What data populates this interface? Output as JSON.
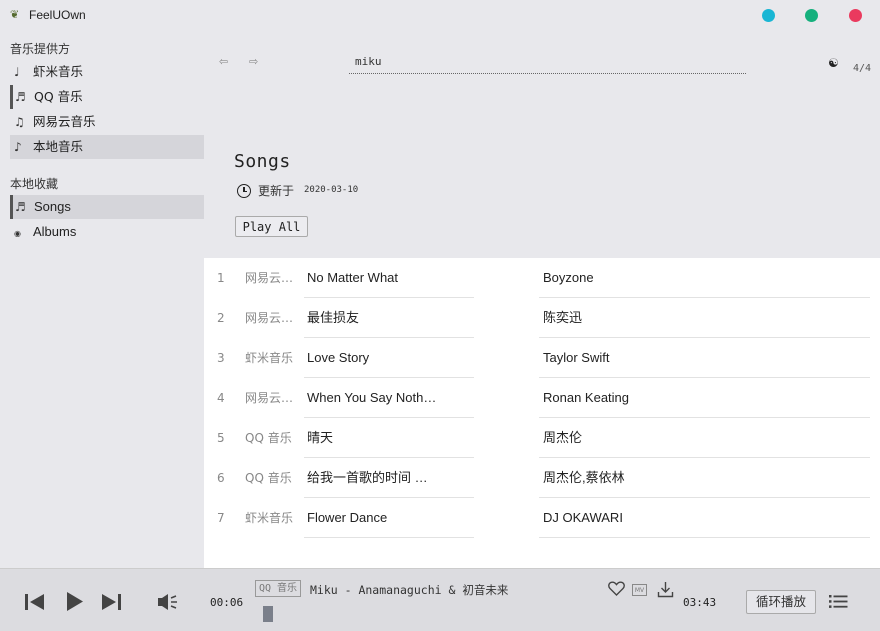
{
  "app": {
    "logo_glyph": "❦",
    "title": "FeelUOwn",
    "window_buttons": {
      "minimize_color": "#19b6d4",
      "maximize_color": "#16b07d",
      "close_color": "#ea3a5e"
    }
  },
  "sidebar": {
    "providers_heading": "音乐提供方",
    "providers": [
      {
        "icon": "♩",
        "label": "虾米音乐"
      },
      {
        "icon": "♬",
        "label": "QQ 音乐"
      },
      {
        "icon": "♫",
        "label": "网易云音乐"
      },
      {
        "icon": "♪",
        "label": "本地音乐"
      }
    ],
    "collections_heading": "本地收藏",
    "collections": [
      {
        "icon": "♬",
        "label": "Songs"
      },
      {
        "icon": "◉",
        "label": "Albums"
      }
    ]
  },
  "topbar": {
    "back_glyph": "⇦",
    "forward_glyph": "⇨",
    "search_value": "miku",
    "theme_glyph": "☯",
    "page_indicator": "4/4"
  },
  "playlist": {
    "title": "Songs",
    "updated_label": "更新于",
    "updated_date": "2020-03-10",
    "play_all_label": "Play All"
  },
  "songs": [
    {
      "index": "1",
      "source": "网易云…",
      "title": "No Matter What",
      "artist": "Boyzone"
    },
    {
      "index": "2",
      "source": "网易云…",
      "title": "最佳损友",
      "artist": "陈奕迅"
    },
    {
      "index": "3",
      "source": "虾米音乐",
      "title": "Love Story",
      "artist": "Taylor Swift"
    },
    {
      "index": "4",
      "source": "网易云…",
      "title": "When You Say Noth…",
      "artist": "Ronan Keating"
    },
    {
      "index": "5",
      "source": "QQ 音乐",
      "title": "晴天",
      "artist": "周杰伦"
    },
    {
      "index": "6",
      "source": "QQ 音乐",
      "title": "给我一首歌的时间 …",
      "artist": "周杰伦,蔡依林"
    },
    {
      "index": "7",
      "source": "虾米音乐",
      "title": "Flower Dance",
      "artist": "DJ OKAWARI"
    }
  ],
  "player": {
    "current_time": "00:06",
    "source_badge": "QQ 音乐",
    "song_info": "Miku - Anamanaguchi & 初音未来",
    "mv_label": "MV",
    "duration": "03:43",
    "playback_mode": "循环播放"
  }
}
